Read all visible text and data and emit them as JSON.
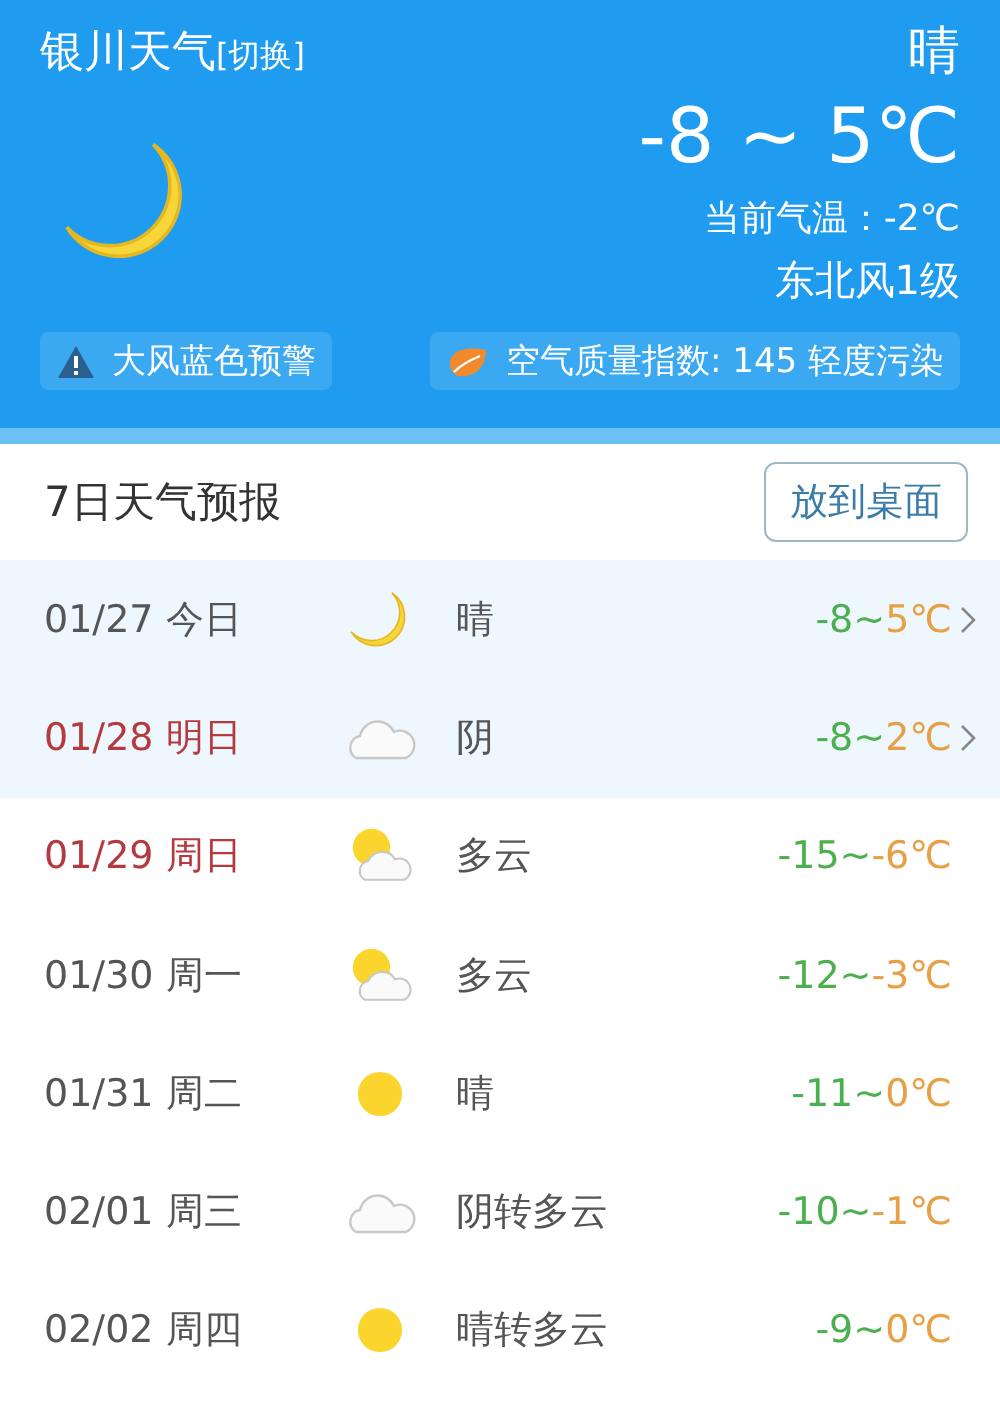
{
  "header": {
    "city": "银川天气",
    "switch_link": "[切换]",
    "condition": "晴",
    "temp_range": "-8 ~ 5℃",
    "current_temp": "当前气温：-2℃",
    "wind": "东北风1级",
    "alerts": [
      {
        "kind": "warning",
        "text": "大风蓝色预警"
      },
      {
        "kind": "air",
        "text": "空气质量指数: 145 轻度污染"
      }
    ]
  },
  "forecast": {
    "title": "7日天气预报",
    "button": "放到桌面",
    "rows": [
      {
        "date": "01/27",
        "day": "今日",
        "weekend": false,
        "highlighted": true,
        "kind": "moon",
        "condition": "晴",
        "low": "-8~",
        "high": "5℃",
        "expandable": true
      },
      {
        "date": "01/28",
        "day": "明日",
        "weekend": true,
        "highlighted": true,
        "kind": "cloud",
        "condition": "阴",
        "low": "-8~",
        "high": "2℃",
        "expandable": true
      },
      {
        "date": "01/29",
        "day": "周日",
        "weekend": true,
        "highlighted": false,
        "kind": "partly",
        "condition": "多云",
        "low": "-15~",
        "high": "-6℃",
        "expandable": false
      },
      {
        "date": "01/30",
        "day": "周一",
        "weekend": false,
        "highlighted": false,
        "kind": "partly",
        "condition": "多云",
        "low": "-12~",
        "high": "-3℃",
        "expandable": false
      },
      {
        "date": "01/31",
        "day": "周二",
        "weekend": false,
        "highlighted": false,
        "kind": "sun",
        "condition": "晴",
        "low": "-11~",
        "high": "0℃",
        "expandable": false
      },
      {
        "date": "02/01",
        "day": "周三",
        "weekend": false,
        "highlighted": false,
        "kind": "cloud",
        "condition": "阴转多云",
        "low": "-10~",
        "high": "-1℃",
        "expandable": false
      },
      {
        "date": "02/02",
        "day": "周四",
        "weekend": false,
        "highlighted": false,
        "kind": "sun",
        "condition": "晴转多云",
        "low": "-9~",
        "high": "0℃",
        "expandable": false
      }
    ]
  }
}
